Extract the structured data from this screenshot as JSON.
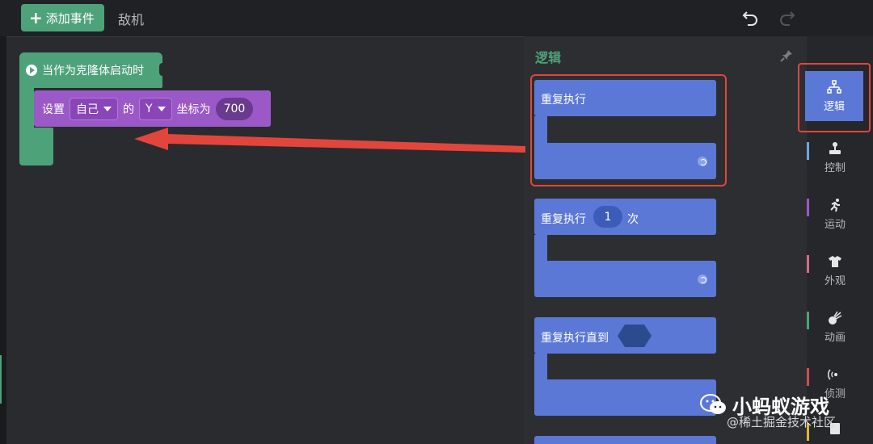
{
  "topbar": {
    "add_event_label": "添加事件",
    "current_tab": "敌机"
  },
  "workspace": {
    "hat_block_label": "当作为克隆体启动时",
    "set_block": {
      "label_set": "设置",
      "target_value": "自己",
      "label_of": "的",
      "axis_value": "Y",
      "label_coord_to": "坐标为",
      "number_value": "700"
    }
  },
  "palette": {
    "title": "逻辑",
    "blocks": [
      {
        "label": "重复执行"
      },
      {
        "label": "重复执行",
        "count": "1",
        "suffix": "次"
      },
      {
        "label": "重复执行直到"
      }
    ]
  },
  "categories": [
    {
      "label": "逻辑",
      "icon": "hierarchy-icon",
      "color": "#5b78d6",
      "active": true
    },
    {
      "label": "控制",
      "icon": "joystick-icon",
      "color": "#6aa7e8"
    },
    {
      "label": "运动",
      "icon": "running-icon",
      "color": "#9b59c8"
    },
    {
      "label": "外观",
      "icon": "shirt-icon",
      "color": "#d86b8a"
    },
    {
      "label": "动画",
      "icon": "comet-icon",
      "color": "#4ea27a"
    },
    {
      "label": "侦测",
      "icon": "radar-icon",
      "color": "#d64a4a"
    }
  ],
  "watermark": {
    "brand": "小蚂蚁游戏",
    "source": "@稀土掘金技术社区"
  },
  "colors": {
    "green": "#4ea27a",
    "purple": "#9b59c8",
    "blue": "#5b78d6",
    "highlight_red": "#e2453c"
  }
}
